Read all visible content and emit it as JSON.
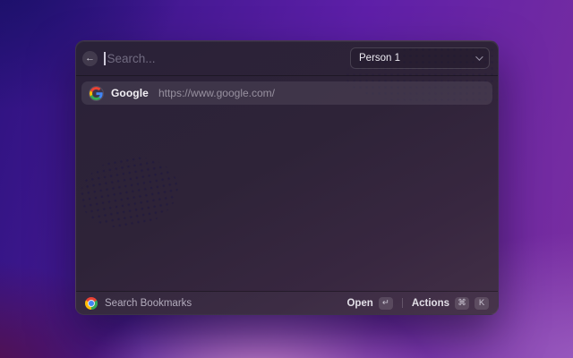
{
  "header": {
    "back_button": {
      "icon": "arrow-left-icon",
      "glyph": "←"
    },
    "search": {
      "placeholder": "Search...",
      "value": ""
    },
    "profile_dropdown": {
      "selected": "Person 1",
      "icon": "chevron-down-icon"
    }
  },
  "results": [
    {
      "icon": "google-favicon",
      "title": "Google",
      "url": "https://www.google.com/",
      "selected": true
    }
  ],
  "footer": {
    "command_icon": "chrome-logo",
    "command_label": "Search Bookmarks",
    "primary_action": {
      "label": "Open",
      "key_glyph": "↵"
    },
    "secondary_action": {
      "label": "Actions",
      "keys": [
        "⌘",
        "K"
      ]
    }
  },
  "colors": {
    "bg_top_left": "#1a1068",
    "bg_top_right": "#5e1fa8",
    "bg_bottom_left": "#54104a",
    "bg_bottom_center": "#d796cb",
    "bg_bottom_right": "#9a5cc0",
    "window_tint": "#2e2338",
    "row_highlight": "rgba(255,255,255,0.085)",
    "google_blue": "#4285F4",
    "google_red": "#EA4335",
    "google_yellow": "#FBBC05",
    "google_green": "#34A853"
  }
}
